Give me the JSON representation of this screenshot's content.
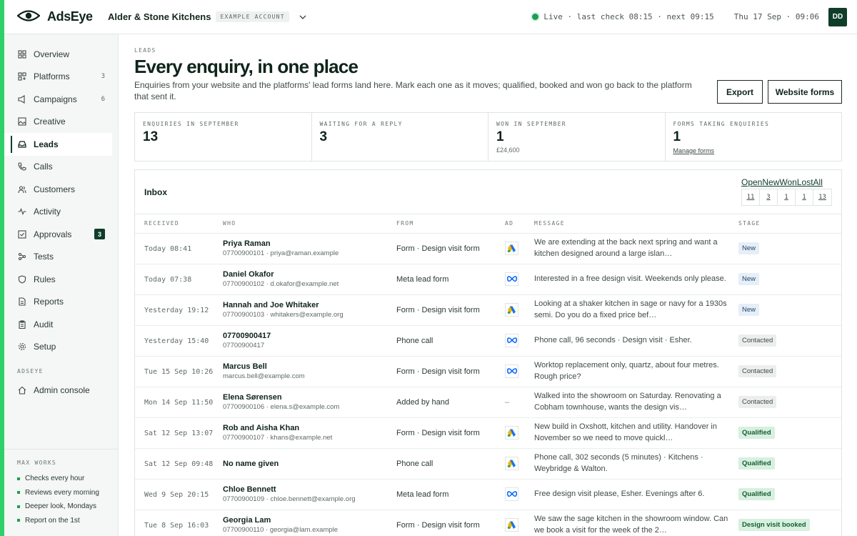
{
  "brand": {
    "name": "AdsEye"
  },
  "account": {
    "name": "Alder & Stone Kitchens",
    "tag": "EXAMPLE ACCOUNT"
  },
  "status": {
    "live_text": "Live · last check 08:15 · next 09:15",
    "datetime": "Thu 17 Sep · 09:06"
  },
  "user": {
    "initials": "DD"
  },
  "sidebar": {
    "items": [
      {
        "label": "Overview",
        "icon": "grid-icon",
        "count": ""
      },
      {
        "label": "Platforms",
        "icon": "platforms-icon",
        "count": "3"
      },
      {
        "label": "Campaigns",
        "icon": "campaigns-icon",
        "count": "6"
      },
      {
        "label": "Creative",
        "icon": "image-icon",
        "count": ""
      },
      {
        "label": "Leads",
        "icon": "inbox-icon",
        "count": ""
      },
      {
        "label": "Calls",
        "icon": "phone-icon",
        "count": ""
      },
      {
        "label": "Customers",
        "icon": "users-icon",
        "count": ""
      },
      {
        "label": "Activity",
        "icon": "activity-icon",
        "count": ""
      },
      {
        "label": "Approvals",
        "icon": "checkbox-icon",
        "count": "3"
      },
      {
        "label": "Tests",
        "icon": "tests-icon",
        "count": ""
      },
      {
        "label": "Rules",
        "icon": "shield-icon",
        "count": ""
      },
      {
        "label": "Reports",
        "icon": "document-icon",
        "count": ""
      },
      {
        "label": "Audit",
        "icon": "clipboard-icon",
        "count": ""
      },
      {
        "label": "Setup",
        "icon": "gear-icon",
        "count": ""
      }
    ],
    "section_label": "ADSEYE",
    "admin_label": "Admin console",
    "maxworks": {
      "label": "MAX WORKS",
      "items": [
        "Checks every hour",
        "Reviews every morning",
        "Deeper look, Mondays",
        "Report on the 1st"
      ]
    }
  },
  "page": {
    "eyebrow": "LEADS",
    "title": "Every enquiry, in one place",
    "description": "Enquiries from your website and the platforms' lead forms land here. Mark each one as it moves; qualified, booked and won go back to the platform that sent it.",
    "export_label": "Export",
    "forms_label": "Website forms"
  },
  "stats": [
    {
      "label": "ENQUIRIES IN SEPTEMBER",
      "value": "13",
      "sub": ""
    },
    {
      "label": "WAITING FOR A REPLY",
      "value": "3",
      "sub": ""
    },
    {
      "label": "WON IN SEPTEMBER",
      "value": "1",
      "sub": "£24,600"
    },
    {
      "label": "FORMS TAKING ENQUIRIES",
      "value": "1",
      "link": "Manage forms"
    }
  ],
  "inbox": {
    "title": "Inbox",
    "filters": [
      {
        "label": "Open",
        "count": "11"
      },
      {
        "label": "New",
        "count": "3"
      },
      {
        "label": "Won",
        "count": "1"
      },
      {
        "label": "Lost",
        "count": "1"
      },
      {
        "label": "All",
        "count": "13"
      }
    ],
    "columns": [
      "RECEIVED",
      "WHO",
      "FROM",
      "AD",
      "MESSAGE",
      "STAGE"
    ],
    "rows": [
      {
        "received": "Today 08:41",
        "name": "Priya Raman",
        "contact": "07700900101 · priya@raman.example",
        "from": "Form · Design visit form",
        "ad": "google",
        "message": "We are extending at the back next spring and want a kitchen designed around a large islan…",
        "stage": "New",
        "stage_class": "st-new"
      },
      {
        "received": "Today 07:38",
        "name": "Daniel Okafor",
        "contact": "07700900102 · d.okafor@example.net",
        "from": "Meta lead form",
        "ad": "meta",
        "message": "Interested in a free design visit. Weekends only please.",
        "stage": "New",
        "stage_class": "st-new"
      },
      {
        "received": "Yesterday 19:12",
        "name": "Hannah and Joe Whitaker",
        "contact": "07700900103 · whitakers@example.org",
        "from": "Form · Design visit form",
        "ad": "google",
        "message": "Looking at a shaker kitchen in sage or navy for a 1930s semi. Do you do a fixed price bef…",
        "stage": "New",
        "stage_class": "st-new"
      },
      {
        "received": "Yesterday 15:40",
        "name": "07700900417",
        "contact": "07700900417",
        "from": "Phone call",
        "ad": "meta",
        "message": "Phone call, 96 seconds · Design visit · Esher.",
        "stage": "Contacted",
        "stage_class": "st-contacted"
      },
      {
        "received": "Tue 15 Sep 10:26",
        "name": "Marcus Bell",
        "contact": "marcus.bell@example.com",
        "from": "Form · Design visit form",
        "ad": "meta",
        "message": "Worktop replacement only, quartz, about four metres. Rough price?",
        "stage": "Contacted",
        "stage_class": "st-contacted"
      },
      {
        "received": "Mon 14 Sep 11:50",
        "name": "Elena Sørensen",
        "contact": "07700900106 · elena.s@example.com",
        "from": "Added by hand",
        "ad": "none",
        "message": "Walked into the showroom on Saturday. Renovating a Cobham townhouse, wants the design vis…",
        "stage": "Contacted",
        "stage_class": "st-contacted"
      },
      {
        "received": "Sat 12 Sep 13:07",
        "name": "Rob and Aisha Khan",
        "contact": "07700900107 · khans@example.net",
        "from": "Form · Design visit form",
        "ad": "google",
        "message": "New build in Oxshott, kitchen and utility. Handover in November so we need to move quickl…",
        "stage": "Qualified",
        "stage_class": "st-qualified"
      },
      {
        "received": "Sat 12 Sep 09:48",
        "name": "No name given",
        "contact": "",
        "from": "Phone call",
        "ad": "google",
        "message": "Phone call, 302 seconds (5 minutes) · Kitchens · Weybridge & Walton.",
        "stage": "Qualified",
        "stage_class": "st-qualified"
      },
      {
        "received": "Wed 9 Sep 20:15",
        "name": "Chloe Bennett",
        "contact": "07700900109 · chloe.bennett@example.org",
        "from": "Meta lead form",
        "ad": "meta",
        "message": "Free design visit please, Esher. Evenings after 6.",
        "stage": "Qualified",
        "stage_class": "st-qualified"
      },
      {
        "received": "Tue 8 Sep 16:03",
        "name": "Georgia Lam",
        "contact": "07700900110 · georgia@lam.example",
        "from": "Form · Design visit form",
        "ad": "google",
        "message": "We saw the sage kitchen in the showroom window. Can we book a visit for the week of the 2…",
        "stage": "Design visit booked",
        "stage_class": "st-booked"
      }
    ],
    "no_ad_text": "–"
  },
  "colors": {
    "accent": "#2fd06a",
    "brand_dark": "#0f3d2a",
    "live": "#1f9d55"
  }
}
